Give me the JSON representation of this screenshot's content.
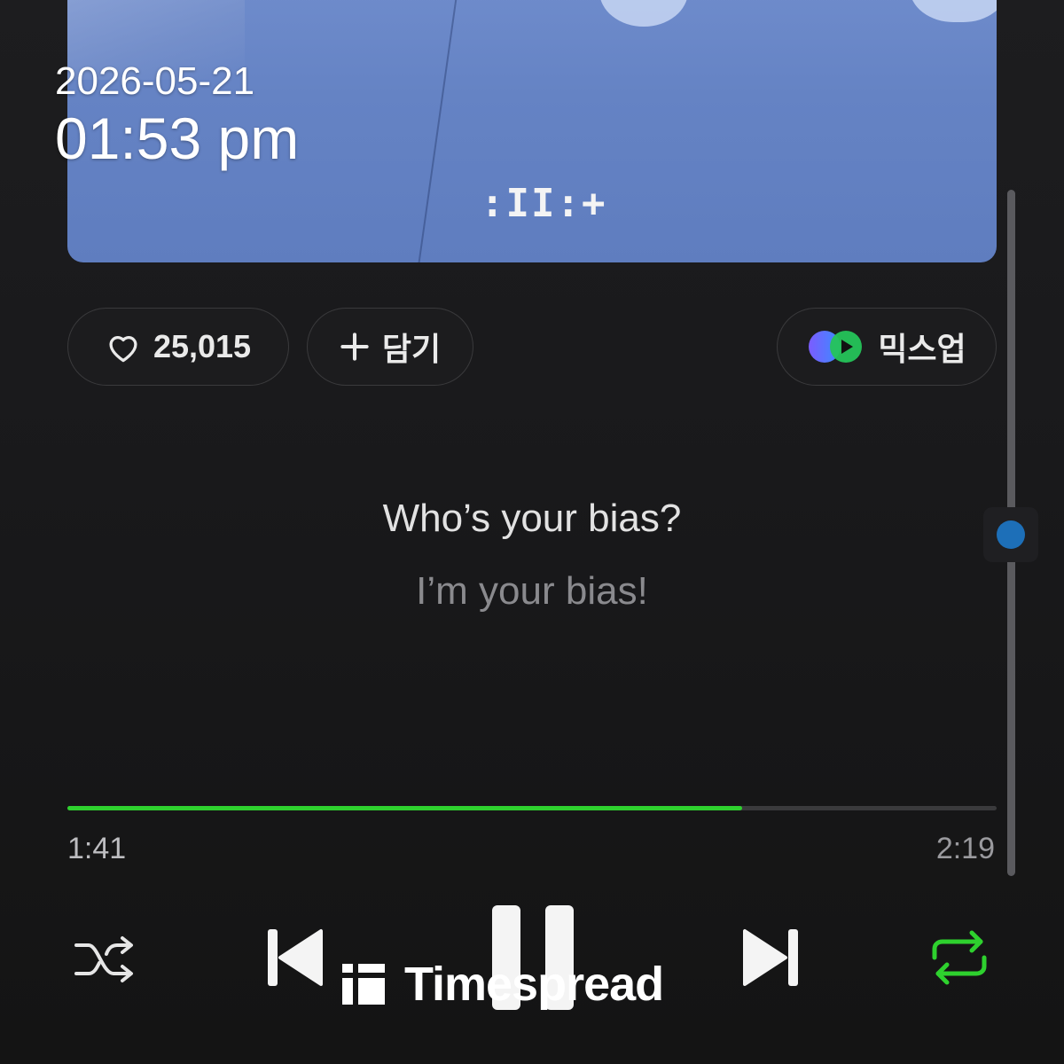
{
  "album": {
    "logo_text": ":II:+",
    "colors": {
      "art_blue": "#6583c4"
    }
  },
  "timestamp": {
    "date": "2026-05-21",
    "time": "01:53 pm"
  },
  "actions": {
    "like_count": "25,015",
    "add_label": "담기",
    "mixup_label": "믹스업",
    "like_icon": "heart-outline-icon",
    "add_icon": "plus-icon",
    "mixup_icon": "mixup-logo-icon"
  },
  "lyrics": {
    "current": "Who’s your bias?",
    "next": "I’m your bias!"
  },
  "playback": {
    "elapsed": "1:41",
    "total": "2:19",
    "progress_fraction": 0.7266,
    "accent_color": "#2ed12e"
  },
  "controls": {
    "shuffle_icon": "shuffle-icon",
    "previous_icon": "skip-previous-icon",
    "pause_icon": "pause-icon",
    "next_icon": "skip-next-icon",
    "repeat_icon": "repeat-icon",
    "repeat_color": "#2ed12e"
  },
  "watermark": {
    "text": "Timespread"
  }
}
